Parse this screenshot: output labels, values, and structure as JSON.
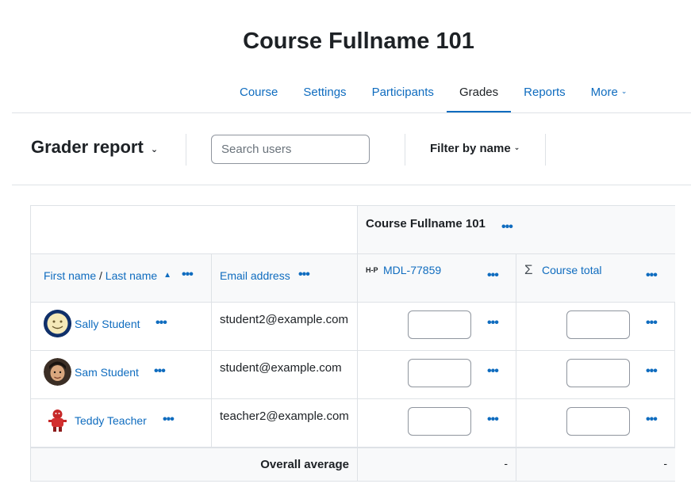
{
  "course": {
    "title": "Course Fullname 101"
  },
  "nav": {
    "items": [
      {
        "label": "Course",
        "active": false
      },
      {
        "label": "Settings",
        "active": false
      },
      {
        "label": "Participants",
        "active": false
      },
      {
        "label": "Grades",
        "active": true
      },
      {
        "label": "Reports",
        "active": false
      },
      {
        "label": "More",
        "active": false
      }
    ]
  },
  "toolbar": {
    "report_label": "Grader report",
    "search_placeholder": "Search users",
    "filter_label": "Filter by name"
  },
  "table": {
    "category_header": "Course Fullname 101",
    "headers": {
      "first_name": "First name",
      "separator": "/",
      "last_name": "Last name",
      "email": "Email address",
      "item": "MDL-77859",
      "total": "Course total"
    },
    "rows": [
      {
        "name": "Sally Student",
        "email": "student2@example.com",
        "item_grade": "",
        "total_grade": ""
      },
      {
        "name": "Sam Student",
        "email": "student@example.com",
        "item_grade": "",
        "total_grade": ""
      },
      {
        "name": "Teddy Teacher",
        "email": "teacher2@example.com",
        "item_grade": "",
        "total_grade": ""
      }
    ],
    "average": {
      "label": "Overall average",
      "item": "-",
      "total": "-"
    }
  },
  "colors": {
    "link": "#0f6cbf",
    "border": "#dee2e6",
    "header_bg": "#f8f9fa"
  }
}
